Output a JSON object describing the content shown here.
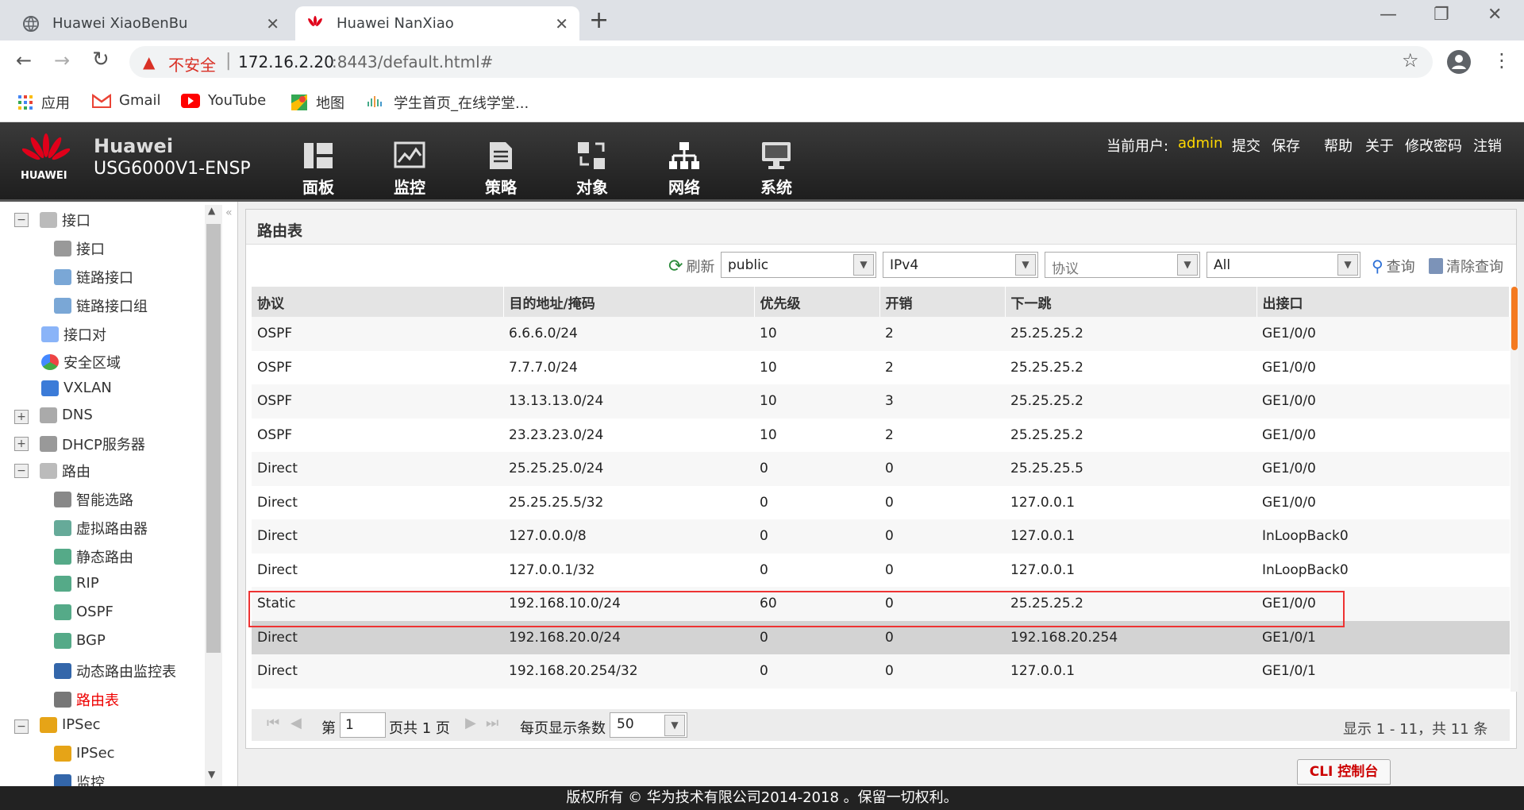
{
  "browser": {
    "tabs": [
      {
        "label": "Huawei XiaoBenBu",
        "active": false
      },
      {
        "label": "Huawei NanXiao",
        "active": true
      }
    ],
    "security_label": "不安全",
    "url_host": "172.16.2.20",
    "url_rest": ":8443/default.html#",
    "bookmarks": [
      {
        "label": "应用",
        "icon": "apps-grid-icon"
      },
      {
        "label": "Gmail",
        "icon": "gmail-icon"
      },
      {
        "label": "YouTube",
        "icon": "youtube-icon"
      },
      {
        "label": "地图",
        "icon": "maps-icon"
      },
      {
        "label": "学生首页_在线学堂...",
        "icon": "site-icon"
      }
    ]
  },
  "app": {
    "brand": "HUAWEI",
    "title_line1": "Huawei",
    "title_line2": "USG6000V1-ENSP",
    "nav": [
      {
        "label": "面板",
        "icon": "dashboard-icon"
      },
      {
        "label": "监控",
        "icon": "monitor-icon"
      },
      {
        "label": "策略",
        "icon": "policy-icon"
      },
      {
        "label": "对象",
        "icon": "object-icon"
      },
      {
        "label": "网络",
        "icon": "network-icon",
        "active": true
      },
      {
        "label": "系统",
        "icon": "system-icon"
      }
    ],
    "current_user_label": "当前用户:",
    "current_user": "admin",
    "links": [
      "提交",
      "保存",
      "帮助",
      "关于",
      "修改密码",
      "注销"
    ]
  },
  "sidebar": {
    "items": [
      {
        "label": "接口",
        "level": 0,
        "expander": "minus"
      },
      {
        "label": "接口",
        "level": 1
      },
      {
        "label": "链路接口",
        "level": 1
      },
      {
        "label": "链路接口组",
        "level": 1
      },
      {
        "label": "接口对",
        "level": 0
      },
      {
        "label": "安全区域",
        "level": 0
      },
      {
        "label": "VXLAN",
        "level": 0
      },
      {
        "label": "DNS",
        "level": 0,
        "expander": "plus"
      },
      {
        "label": "DHCP服务器",
        "level": 0,
        "expander": "plus"
      },
      {
        "label": "路由",
        "level": 0,
        "expander": "minus"
      },
      {
        "label": "智能选路",
        "level": 1
      },
      {
        "label": "虚拟路由器",
        "level": 1
      },
      {
        "label": "静态路由",
        "level": 1
      },
      {
        "label": "RIP",
        "level": 1
      },
      {
        "label": "OSPF",
        "level": 1
      },
      {
        "label": "BGP",
        "level": 1
      },
      {
        "label": "动态路由监控表",
        "level": 1
      },
      {
        "label": "路由表",
        "level": 1,
        "selected": true
      },
      {
        "label": "IPSec",
        "level": 0,
        "expander": "minus"
      },
      {
        "label": "IPSec",
        "level": 1
      },
      {
        "label": "监控",
        "level": 1
      }
    ]
  },
  "panel": {
    "title": "路由表",
    "refresh_label": "刷新",
    "filters": {
      "vpn": "public",
      "ip_version": "IPv4",
      "protocol_placeholder": "协议",
      "scope": "All"
    },
    "query_label": "查询",
    "clear_query_label": "清除查询",
    "columns": [
      "协议",
      "目的地址/掩码",
      "优先级",
      "开销",
      "下一跳",
      "出接口"
    ],
    "rows": [
      [
        "OSPF",
        "6.6.6.0/24",
        "10",
        "2",
        "25.25.25.2",
        "GE1/0/0"
      ],
      [
        "OSPF",
        "7.7.7.0/24",
        "10",
        "2",
        "25.25.25.2",
        "GE1/0/0"
      ],
      [
        "OSPF",
        "13.13.13.0/24",
        "10",
        "3",
        "25.25.25.2",
        "GE1/0/0"
      ],
      [
        "OSPF",
        "23.23.23.0/24",
        "10",
        "2",
        "25.25.25.2",
        "GE1/0/0"
      ],
      [
        "Direct",
        "25.25.25.0/24",
        "0",
        "0",
        "25.25.25.5",
        "GE1/0/0"
      ],
      [
        "Direct",
        "25.25.25.5/32",
        "0",
        "0",
        "127.0.0.1",
        "GE1/0/0"
      ],
      [
        "Direct",
        "127.0.0.0/8",
        "0",
        "0",
        "127.0.0.1",
        "InLoopBack0"
      ],
      [
        "Direct",
        "127.0.0.1/32",
        "0",
        "0",
        "127.0.0.1",
        "InLoopBack0"
      ],
      [
        "Static",
        "192.168.10.0/24",
        "60",
        "0",
        "25.25.25.2",
        "GE1/0/0"
      ],
      [
        "Direct",
        "192.168.20.0/24",
        "0",
        "0",
        "192.168.20.254",
        "GE1/0/1"
      ],
      [
        "Direct",
        "192.168.20.254/32",
        "0",
        "0",
        "127.0.0.1",
        "GE1/0/1"
      ]
    ],
    "pager": {
      "page_prefix": "第",
      "page_value": "1",
      "page_suffix": "页共 1 页",
      "per_page_label": "每页显示条数",
      "per_page_value": "50",
      "summary": "显示 1 - 11，共 11 条"
    },
    "cli_button": "CLI 控制台"
  },
  "footer": {
    "copyright": "版权所有 © 华为技术有限公司2014-2018 。保留一切权利。"
  }
}
